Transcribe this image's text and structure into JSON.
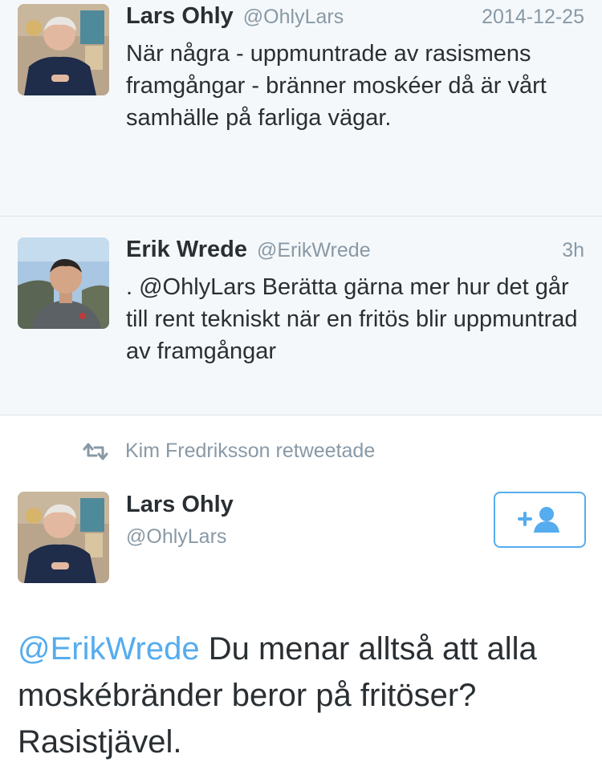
{
  "tweets": [
    {
      "author_name": "Lars Ohly",
      "author_handle": "@OhlyLars",
      "timestamp": "2014-12-25",
      "text": "När några - uppmuntrade av rasismens framgångar - bränner moskéer då är vårt samhälle på farliga vägar.",
      "avatar_icon": "person-photo-avatar"
    },
    {
      "author_name": "Erik Wrede",
      "author_handle": "@ErikWrede",
      "timestamp": "3h",
      "text": ". @OhlyLars Berätta gärna mer hur det går till rent tekniskt när en fritös blir uppmuntrad av framgångar",
      "avatar_icon": "person-photo-avatar"
    }
  ],
  "retweet": {
    "icon": "retweet-icon",
    "label": "Kim Fredriksson retweetade"
  },
  "focused_tweet": {
    "author_name": "Lars Ohly",
    "author_handle": "@OhlyLars",
    "follow_icon": "add-user-icon",
    "mention": "@ErikWrede",
    "text": " Du menar alltså att alla moskébränder beror på fritöser? Rasistjävel."
  },
  "colors": {
    "accent": "#55acee",
    "secondary_text": "#8899a6",
    "primary_text": "#292f33",
    "grey_background": "#f5f8fa"
  }
}
